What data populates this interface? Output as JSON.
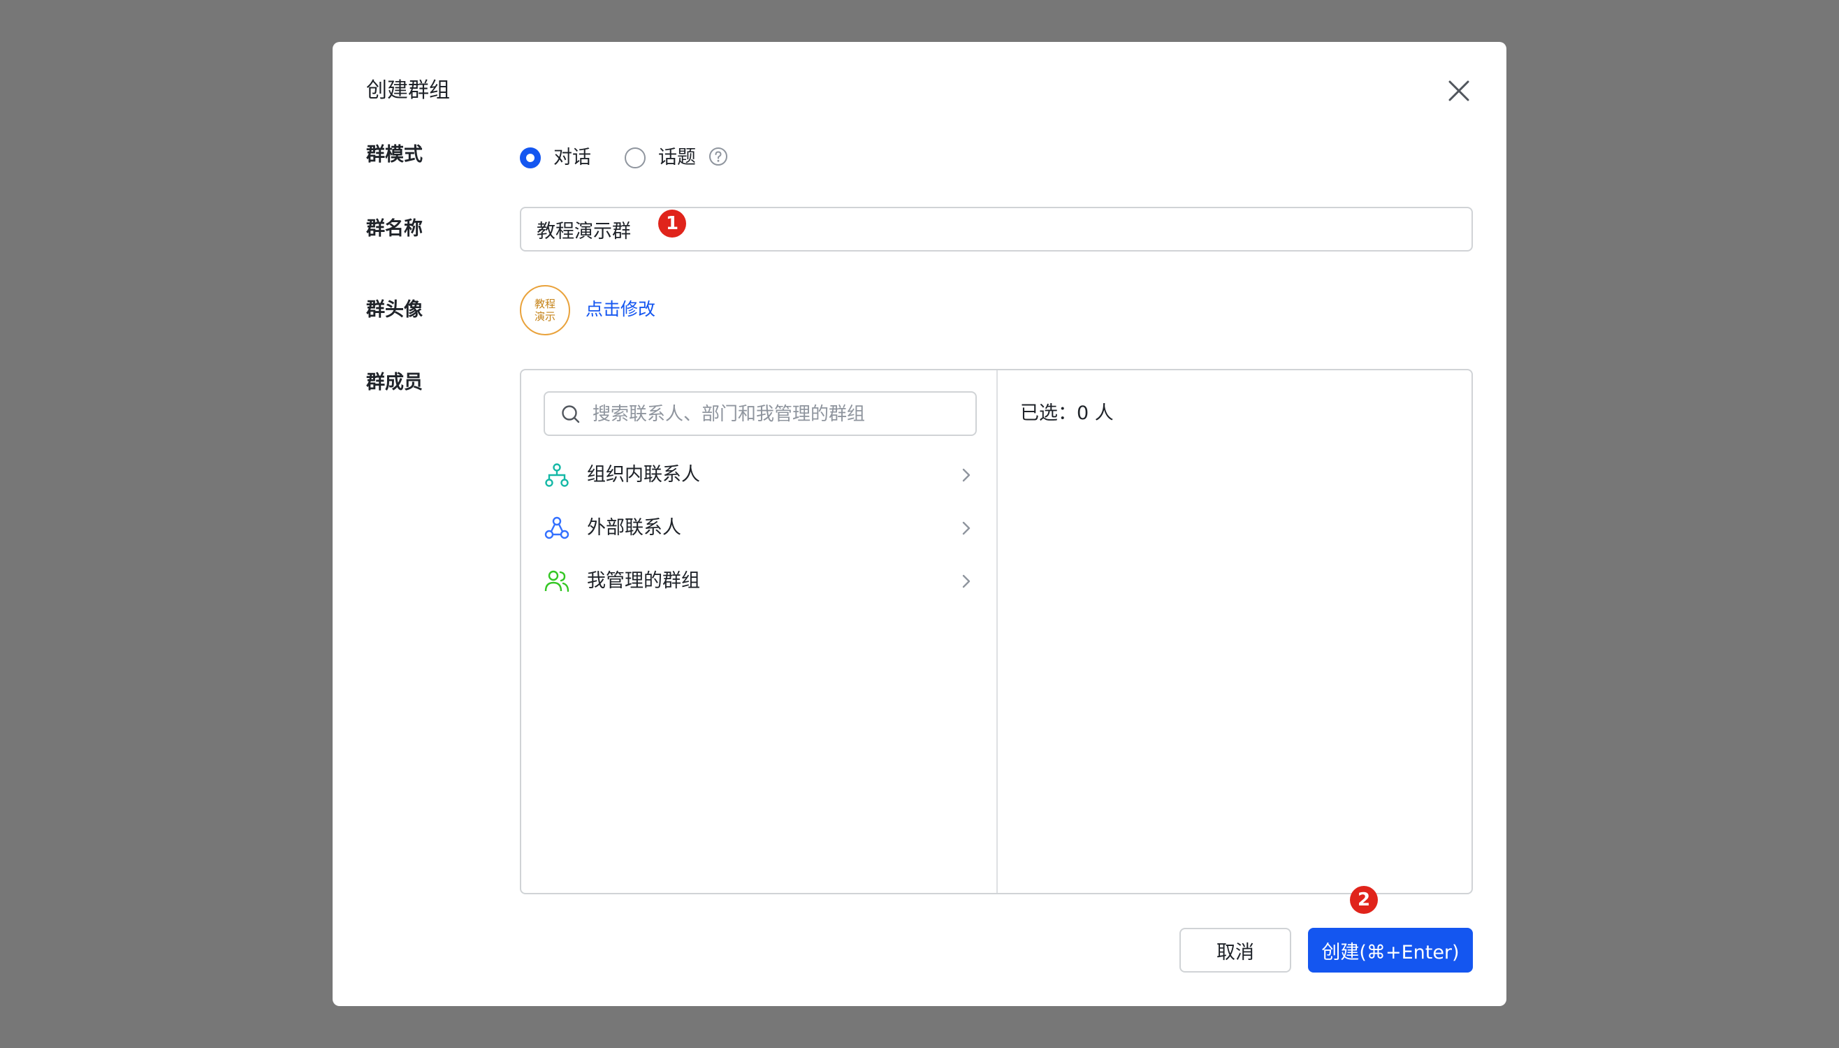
{
  "dialog": {
    "title": "创建群组",
    "close_icon": "close-icon"
  },
  "mode": {
    "label": "群模式",
    "options": [
      {
        "label": "对话",
        "checked": true
      },
      {
        "label": "话题",
        "checked": false
      }
    ],
    "help_icon": "question-circle-icon"
  },
  "name": {
    "label": "群名称",
    "value": "教程演示群"
  },
  "avatar": {
    "label": "群头像",
    "text_line1": "教程",
    "text_line2": "演示",
    "edit_link": "点击修改",
    "border_color": "#e9a23b"
  },
  "members": {
    "label": "群成员",
    "search_placeholder": "搜索联系人、部门和我管理的群组",
    "sources": [
      {
        "label": "组织内联系人",
        "icon": "org-tree-icon",
        "color": "#14b8a6"
      },
      {
        "label": "外部联系人",
        "icon": "external-contacts-icon",
        "color": "#3370ff"
      },
      {
        "label": "我管理的群组",
        "icon": "managed-groups-icon",
        "color": "#34c724"
      }
    ],
    "selected_text": "已选：0 人"
  },
  "footer": {
    "cancel_label": "取消",
    "create_label": "创建(⌘+Enter)"
  },
  "annotations": {
    "badge_1": "1",
    "badge_2": "2",
    "badge_color": "#e0241b"
  },
  "colors": {
    "accent": "#1456f0",
    "backdrop": "#777777"
  }
}
